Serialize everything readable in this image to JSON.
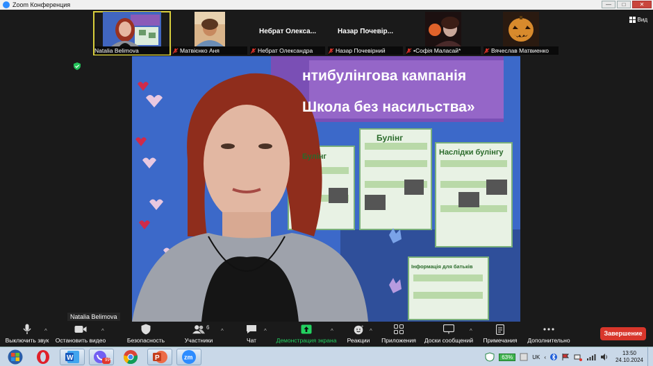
{
  "window": {
    "title": "Zoom Конференция",
    "controls": [
      "—",
      "□",
      "✕"
    ]
  },
  "participants": [
    {
      "name": "Natalia Belimova",
      "muted": false,
      "has_video": true,
      "active": true
    },
    {
      "name": "Матвієнко Аня",
      "muted": true,
      "has_video": true
    },
    {
      "name": "Небрат Олександра",
      "display": "Небрат Олекса...",
      "muted": true,
      "has_video": false
    },
    {
      "name": "Назар Почевірний",
      "display": "Назар Почевір...",
      "muted": true,
      "has_video": false
    },
    {
      "name": "•Софія Маласай*",
      "muted": true,
      "has_video": true
    },
    {
      "name": "Вячеслав Матвиенко",
      "muted": true,
      "has_video": true
    }
  ],
  "view_button": {
    "label": "Вид"
  },
  "main_video": {
    "speaker_name": "Natalia Belimova",
    "banner_line1": "нтибулінгова кампанія",
    "banner_line2": "Школа без насильства»",
    "poster_titles": [
      "Булінг",
      "Наслідки булінгу",
      "Булінг",
      "Інформація для батьків"
    ]
  },
  "toolbar": {
    "mute": "Выключить звук",
    "video": "Остановить видео",
    "security": "Безопасность",
    "participants": "Участники",
    "participants_count": "6",
    "chat": "Чат",
    "share": "Демонстрация экрана",
    "reactions": "Реакции",
    "apps": "Приложения",
    "whiteboards": "Доски сообщений",
    "notes": "Примечания",
    "more": "Дополнительно",
    "end": "Завершение"
  },
  "taskbar": {
    "language": "UK",
    "battery": "63%",
    "time": "13:50",
    "date": "24.10.2024",
    "viber_badge": "99+",
    "apps": [
      "start",
      "opera",
      "word",
      "viber",
      "chrome",
      "powerpoint",
      "zoom"
    ]
  },
  "colors": {
    "share_green": "#23d160",
    "end_red": "#d8362b",
    "active_outline": "#d9cf3c",
    "muted_red": "#e0352b"
  }
}
